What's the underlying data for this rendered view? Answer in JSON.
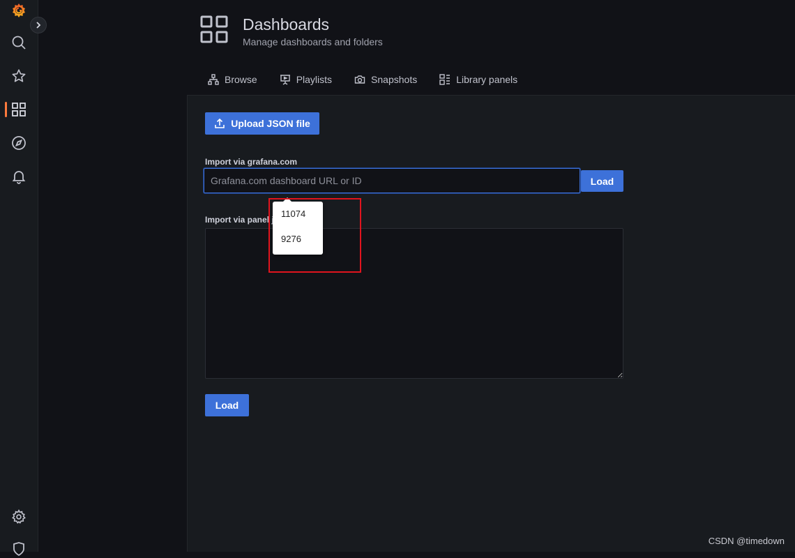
{
  "sidebar": {
    "items": [
      {
        "icon": "grafana-logo-icon"
      },
      {
        "icon": "search-icon"
      },
      {
        "icon": "star-icon"
      },
      {
        "icon": "dashboards-grid-icon",
        "active": true
      },
      {
        "icon": "explore-compass-icon"
      },
      {
        "icon": "alerting-bell-icon"
      },
      {
        "icon": "settings-gear-icon"
      },
      {
        "icon": "shield-icon"
      }
    ],
    "active_color": "#ff7a3d"
  },
  "header": {
    "title": "Dashboards",
    "subtitle": "Manage dashboards and folders",
    "tabs": [
      {
        "label": "Browse",
        "icon": "sitemap-icon"
      },
      {
        "label": "Playlists",
        "icon": "presentation-play-icon"
      },
      {
        "label": "Snapshots",
        "icon": "camera-icon"
      },
      {
        "label": "Library panels",
        "icon": "library-panel-icon"
      }
    ]
  },
  "import": {
    "upload_label": "Upload JSON file",
    "grafana_com_label": "Import via grafana.com",
    "grafana_com_placeholder": "Grafana.com dashboard URL or ID",
    "grafana_com_value": "",
    "load_label": "Load",
    "panel_json_label": "Import via panel json",
    "panel_json_value": "",
    "load_bottom_label": "Load"
  },
  "autocomplete": {
    "options": [
      "11074",
      "9276"
    ]
  },
  "colors": {
    "primary": "#3d71d9",
    "annotation": "#e0141e"
  },
  "watermark": "CSDN @timedown"
}
